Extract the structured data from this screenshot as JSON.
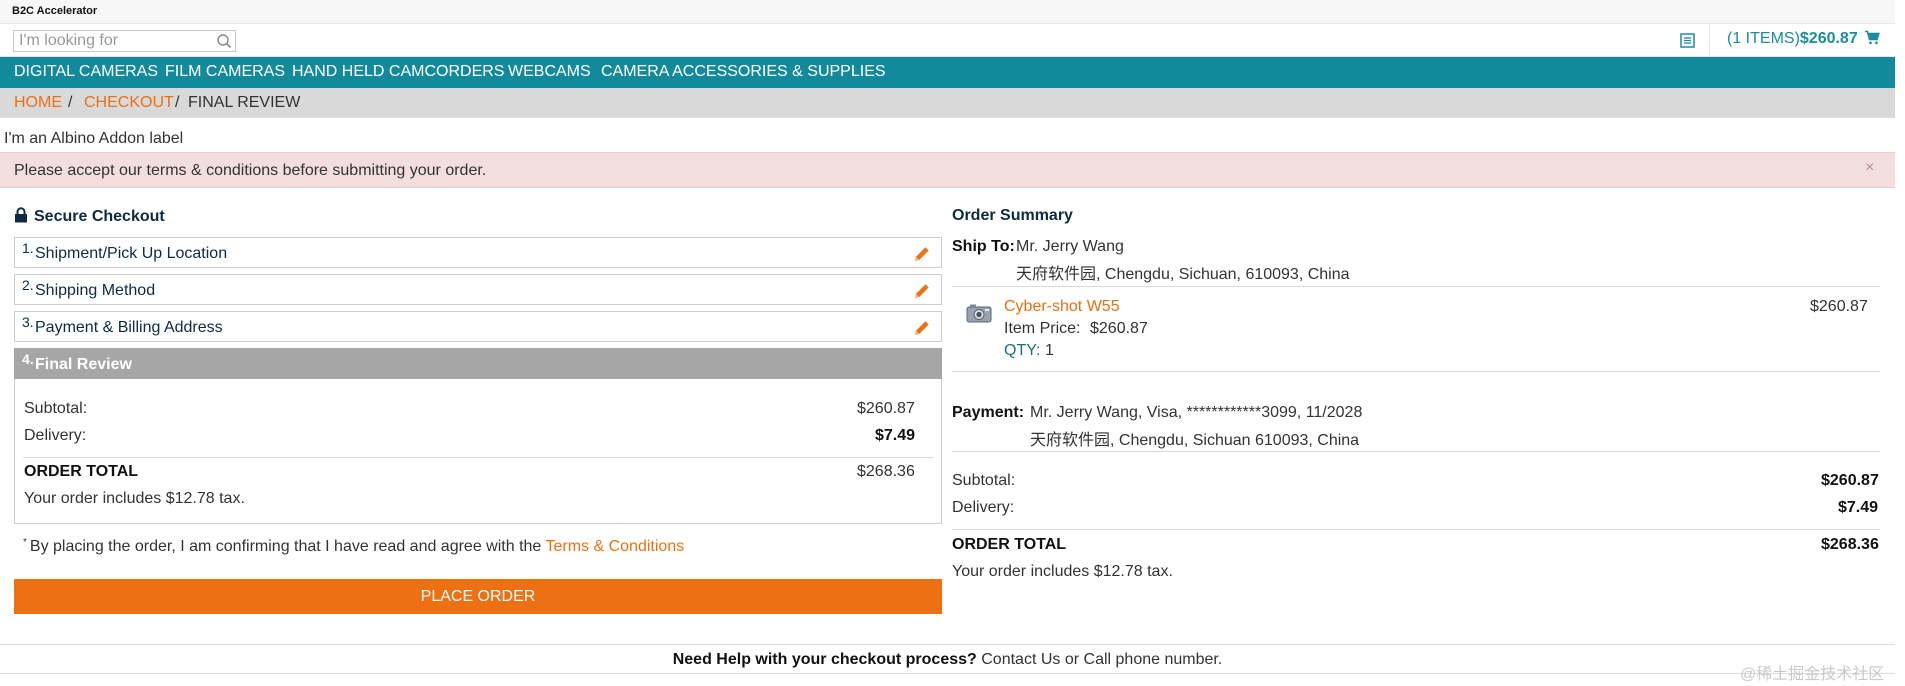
{
  "app": {
    "brand": "B2C Accelerator"
  },
  "search": {
    "placeholder": "I'm looking for"
  },
  "header": {
    "mini_cart_items": "(1 ITEMS)",
    "mini_cart_total": "$260.87"
  },
  "nav": {
    "items": [
      "DIGITAL CAMERAS",
      "FILM CAMERAS",
      "HAND HELD CAMCORDERS",
      "WEBCAMS",
      "CAMERA ACCESSORIES & SUPPLIES"
    ]
  },
  "breadcrumb": {
    "home": "HOME",
    "checkout": "CHECKOUT",
    "current": "FINAL REVIEW",
    "sep": "/"
  },
  "addon_label": "I'm an Albino Addon label",
  "alert": {
    "message": "Please accept our terms & conditions before submitting your order.",
    "close": "×"
  },
  "checkout": {
    "title": "Secure Checkout",
    "steps": [
      {
        "num": "1.",
        "label": "Shipment/Pick Up Location"
      },
      {
        "num": "2.",
        "label": "Shipping Method"
      },
      {
        "num": "3.",
        "label": "Payment & Billing Address"
      },
      {
        "num": "4.",
        "label": "Final Review"
      }
    ],
    "subtotal_label": "Subtotal:",
    "subtotal": "$260.87",
    "delivery_label": "Delivery:",
    "delivery": "$7.49",
    "order_total_label": "ORDER TOTAL",
    "order_total": "$268.36",
    "tax_note": "Your order includes $12.78 tax.",
    "terms_asterisk": "*",
    "terms_text": "By placing the order, I am confirming that I have read and agree with the",
    "terms_link": "Terms & Conditions",
    "place_order": "PLACE ORDER"
  },
  "summary": {
    "title": "Order Summary",
    "ship_to_label": "Ship To:",
    "ship_to_name": "Mr. Jerry Wang",
    "ship_to_address": "天府软件园,  Chengdu,  Sichuan,  610093,  China",
    "product_name": "Cyber-shot W55",
    "product_total": "$260.87",
    "item_price_label": "Item Price:",
    "item_price": "$260.87",
    "qty_label": "QTY:",
    "qty": "1",
    "payment_label": "Payment:",
    "payment_line1": "Mr. Jerry Wang, Visa, ************3099, 11/2028",
    "payment_line2": "天府软件园, Chengdu, Sichuan 610093, China",
    "subtotal_label": "Subtotal:",
    "subtotal": "$260.87",
    "delivery_label": "Delivery:",
    "delivery": "$7.49",
    "order_total_label": "ORDER TOTAL",
    "order_total": "$268.36",
    "tax_note": "Your order includes $12.78 tax."
  },
  "footer": {
    "help_bold": "Need Help with your checkout process?",
    "help_text": "Contact Us or Call phone number."
  },
  "watermark": "@稀土掘金技术社区",
  "colors": {
    "nav_bg": "#138a9c",
    "link": "#ed7012",
    "place_order": "#ed7012",
    "alert_bg": "#f2dede",
    "active_step": "#a6a6a6"
  }
}
